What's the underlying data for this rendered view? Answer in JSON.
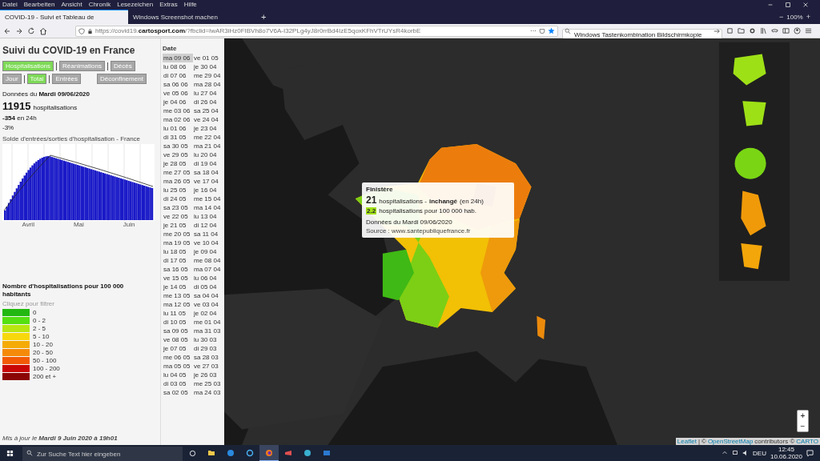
{
  "browser": {
    "menu": [
      "Datei",
      "Bearbeiten",
      "Ansicht",
      "Chronik",
      "Lesezeichen",
      "Extras",
      "Hilfe"
    ],
    "tabs": [
      {
        "title": "COVID-19 - Suivi et Tableau de",
        "selected": true
      },
      {
        "title": "Windows Screenshot machen",
        "selected": false
      }
    ],
    "new_tab": "+",
    "zoom": "100%",
    "zoom_out": "−",
    "zoom_in": "+",
    "url": "https://covid19.**cartosport.com**/?fbclid=IwAR3iHz0FIBVh8o7V6A-I32PLg4yJ8r0rrBd4IzE5qoxKFhVTrUYsR4korbE",
    "more": "···",
    "search_value": "Windows Tastenkombination Bildschirmkopie"
  },
  "panel": {
    "title": "Suivi du COVID-19 en France",
    "metric_buttons": [
      {
        "label": "Hospitalisations",
        "selected": true
      },
      {
        "label": "Réanimations",
        "selected": false
      },
      {
        "label": "Décès",
        "selected": false
      }
    ],
    "mode_buttons": [
      {
        "label": "Jour",
        "selected": false
      },
      {
        "label": "Total",
        "selected": true
      },
      {
        "label": "Entrées",
        "selected": false
      }
    ],
    "extra_button": {
      "label": "Déconfinement",
      "selected": false
    },
    "date_line": "Données du **Mardi 09/06/2020**",
    "total": "11915",
    "total_unit": "hospitalisations",
    "change": "**-354** en 24h",
    "percent": "-3%",
    "chart_title": "Solde d'entrées/sorties d'hospitalisation - France",
    "axis_labels": [
      "Avril",
      "Mai",
      "Juin"
    ],
    "legend_title": "Nombre d'hospitalisations pour 100 000 habitants",
    "legend_hint": "Cliquez pour filtrer",
    "legend": [
      {
        "label": "0",
        "color": "#22b811"
      },
      {
        "label": "0 - 2",
        "color": "#55e011"
      },
      {
        "label": "2 - 5",
        "color": "#b8e611"
      },
      {
        "label": "5 - 10",
        "color": "#f7d80c"
      },
      {
        "label": "10 - 20",
        "color": "#f5ab07"
      },
      {
        "label": "20 - 50",
        "color": "#f58a0a"
      },
      {
        "label": "50 - 100",
        "color": "#f25a05"
      },
      {
        "label": "100 - 200",
        "color": "#c90606"
      },
      {
        "label": "200 et +",
        "color": "#8c0505"
      }
    ],
    "updated": "Mis à jour le **Mardi 9 Juin 2020 à 19h01**"
  },
  "dates": {
    "header": "Date",
    "items": [
      {
        "label": "ma 09 06",
        "selected": true
      },
      {
        "label": "lu 08 06",
        "selected": false
      },
      {
        "label": "di 07 06",
        "selected": false
      },
      {
        "label": "sa 06 06",
        "selected": false
      },
      {
        "label": "ve 05 06",
        "selected": false
      },
      {
        "label": "je 04 06",
        "selected": false
      },
      {
        "label": "me 03 06",
        "selected": false
      },
      {
        "label": "ma 02 06",
        "selected": false
      },
      {
        "label": "lu 01 06",
        "selected": false
      },
      {
        "label": "di 31 05",
        "selected": false
      },
      {
        "label": "sa 30 05",
        "selected": false
      },
      {
        "label": "ve 29 05",
        "selected": false
      },
      {
        "label": "je 28 05",
        "selected": false
      },
      {
        "label": "me 27 05",
        "selected": false
      },
      {
        "label": "ma 26 05",
        "selected": false
      },
      {
        "label": "lu 25 05",
        "selected": false
      },
      {
        "label": "di 24 05",
        "selected": false
      },
      {
        "label": "sa 23 05",
        "selected": false
      },
      {
        "label": "ve 22 05",
        "selected": false
      },
      {
        "label": "je 21 05",
        "selected": false
      },
      {
        "label": "me 20 05",
        "selected": false
      },
      {
        "label": "ma 19 05",
        "selected": false
      },
      {
        "label": "lu 18 05",
        "selected": false
      },
      {
        "label": "di 17 05",
        "selected": false
      },
      {
        "label": "sa 16 05",
        "selected": false
      },
      {
        "label": "ve 15 05",
        "selected": false
      },
      {
        "label": "je 14 05",
        "selected": false
      },
      {
        "label": "me 13 05",
        "selected": false
      },
      {
        "label": "ma 12 05",
        "selected": false
      },
      {
        "label": "lu 11 05",
        "selected": false
      },
      {
        "label": "di 10 05",
        "selected": false
      },
      {
        "label": "sa 09 05",
        "selected": false
      },
      {
        "label": "ve 08 05",
        "selected": false
      },
      {
        "label": "je 07 05",
        "selected": false
      },
      {
        "label": "me 06 05",
        "selected": false
      },
      {
        "label": "ma 05 05",
        "selected": false
      },
      {
        "label": "lu 04 05",
        "selected": false
      },
      {
        "label": "di 03 05",
        "selected": false
      },
      {
        "label": "sa 02 05",
        "selected": false
      },
      {
        "label": "ve 01 05",
        "selected": false
      },
      {
        "label": "je 30 04",
        "selected": false
      },
      {
        "label": "me 29 04",
        "selected": false
      },
      {
        "label": "ma 28 04",
        "selected": false
      },
      {
        "label": "lu 27 04",
        "selected": false
      },
      {
        "label": "di 26 04",
        "selected": false
      },
      {
        "label": "sa 25 04",
        "selected": false
      },
      {
        "label": "ve 24 04",
        "selected": false
      },
      {
        "label": "je 23 04",
        "selected": false
      },
      {
        "label": "me 22 04",
        "selected": false
      },
      {
        "label": "ma 21 04",
        "selected": false
      },
      {
        "label": "lu 20 04",
        "selected": false
      },
      {
        "label": "di 19 04",
        "selected": false
      },
      {
        "label": "sa 18 04",
        "selected": false
      },
      {
        "label": "ve 17 04",
        "selected": false
      },
      {
        "label": "je 16 04",
        "selected": false
      },
      {
        "label": "me 15 04",
        "selected": false
      },
      {
        "label": "ma 14 04",
        "selected": false
      },
      {
        "label": "lu 13 04",
        "selected": false
      },
      {
        "label": "di 12 04",
        "selected": false
      },
      {
        "label": "sa 11 04",
        "selected": false
      },
      {
        "label": "ve 10 04",
        "selected": false
      },
      {
        "label": "je 09 04",
        "selected": false
      },
      {
        "label": "me 08 04",
        "selected": false
      },
      {
        "label": "ma 07 04",
        "selected": false
      },
      {
        "label": "lu 06 04",
        "selected": false
      },
      {
        "label": "di 05 04",
        "selected": false
      },
      {
        "label": "sa 04 04",
        "selected": false
      },
      {
        "label": "ve 03 04",
        "selected": false
      },
      {
        "label": "je 02 04",
        "selected": false
      },
      {
        "label": "me 01 04",
        "selected": false
      },
      {
        "label": "ma 31 03",
        "selected": false
      },
      {
        "label": "lu 30 03",
        "selected": false
      },
      {
        "label": "di 29 03",
        "selected": false
      },
      {
        "label": "sa 28 03",
        "selected": false
      },
      {
        "label": "ve 27 03",
        "selected": false
      },
      {
        "label": "je 26 03",
        "selected": false
      },
      {
        "label": "me 25 03",
        "selected": false
      },
      {
        "label": "ma 24 03",
        "selected": false
      }
    ]
  },
  "map": {
    "kind": "picture",
    "tooltip": {
      "title": "Finistère",
      "count": "21",
      "count_text": "hospitalisations -",
      "trend": "inchangé",
      "trend_note": "(en 24h)",
      "rate": "2.2",
      "rate_text": "hospitalisations pour 100 000 hab.",
      "date": "Données du Mardi 09/06/2020",
      "source": "Source : www.santepubliquefrance.fr"
    },
    "zoom_in": "+",
    "zoom_out": "−",
    "attribution": [
      {
        "text": "Leaflet",
        "link": true
      },
      {
        "text": "|",
        "link": false
      },
      {
        "text": "©",
        "link": false
      },
      {
        "text": "OpenStreetMap",
        "link": true
      },
      {
        "text": "contributors ©",
        "link": false
      },
      {
        "text": "CARTO",
        "link": true
      }
    ]
  },
  "taskbar": {
    "search_placeholder": "Zur Suche Text hier eingeben",
    "language": "DEU",
    "time": "12:45",
    "date": "10.06.2020"
  }
}
